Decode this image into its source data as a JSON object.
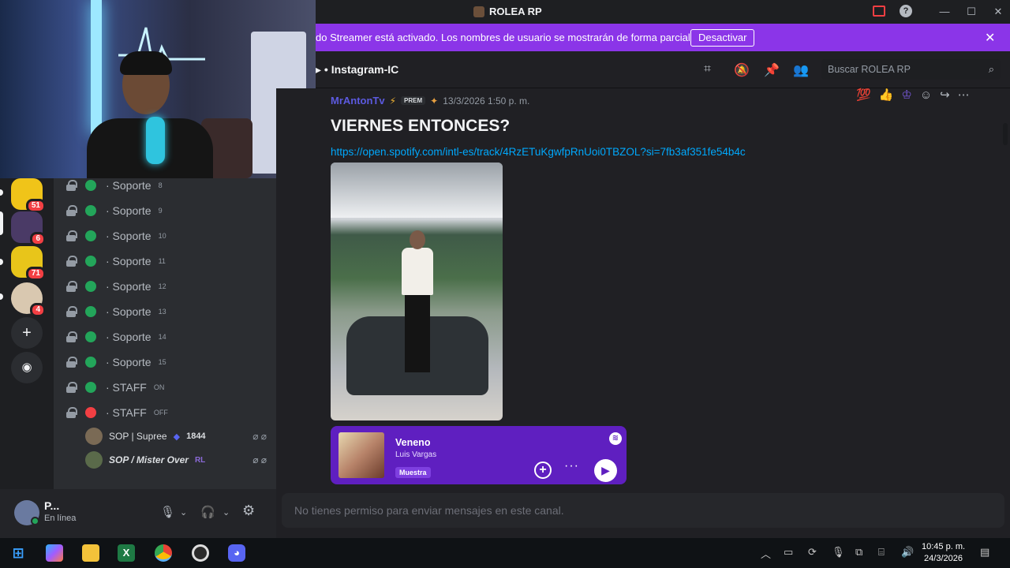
{
  "window": {
    "title": "ROLEA RP",
    "controls": {
      "minimize": "—",
      "maximize": "☐",
      "close": "✕"
    }
  },
  "banner": {
    "text": "do Streamer está activado. Los nombres de usuario se mostrarán de forma parcial.",
    "button": "Desactivar",
    "close": "✕"
  },
  "sidebar_servers": [
    {
      "badge": "51",
      "color": "#f0c419"
    },
    {
      "badge": "6",
      "color": "#4a3a66"
    },
    {
      "badge": "71",
      "color": "#e8c51a"
    },
    {
      "badge": "4",
      "color": "#d9c8b0"
    }
  ],
  "server_actions": {
    "add": "+",
    "explore": "◉"
  },
  "voice_channels": [
    {
      "name": "Soporte",
      "sub": "8",
      "status": "green"
    },
    {
      "name": "Soporte",
      "sub": "9",
      "status": "green"
    },
    {
      "name": "Soporte",
      "sub": "10",
      "status": "green"
    },
    {
      "name": "Soporte",
      "sub": "11",
      "status": "green"
    },
    {
      "name": "Soporte",
      "sub": "12",
      "status": "green"
    },
    {
      "name": "Soporte",
      "sub": "13",
      "status": "green"
    },
    {
      "name": "Soporte",
      "sub": "14",
      "status": "green"
    },
    {
      "name": "Soporte",
      "sub": "15",
      "status": "green"
    },
    {
      "name": "STAFF",
      "sub": "ON",
      "status": "green"
    },
    {
      "name": "STAFF",
      "sub": "OFF",
      "status": "red"
    }
  ],
  "voice_users": [
    {
      "name": "SOP | Supree",
      "extra": "1844"
    },
    {
      "name": "SOP / Mister Over",
      "extra": "RL"
    }
  ],
  "user_panel": {
    "name": "P...",
    "status": "En línea"
  },
  "channel_header": {
    "name": "Instagram-IC",
    "search_placeholder": "Buscar ROLEA RP"
  },
  "message": {
    "author": "MrAntonTv",
    "tag": "PREM",
    "timestamp": "13/3/2026 1:50 p. m.",
    "title": "VIERNES ENTONCES?",
    "link": "https://open.spotify.com/intl-es/track/4RzETuKgwfpRnUoi0TBZOL?si=7fb3af351fe54b4c"
  },
  "spotify": {
    "track": "Veneno",
    "artist": "Luis Vargas",
    "sample_label": "Muestra"
  },
  "input": {
    "placeholder": "No tienes permiso para enviar mensajes en este canal."
  },
  "clock": {
    "time": "10:45 p. m.",
    "date": "24/3/2026"
  },
  "taskbar_apps": [
    "copilot",
    "files",
    "excel",
    "chrome",
    "obs",
    "discord"
  ]
}
